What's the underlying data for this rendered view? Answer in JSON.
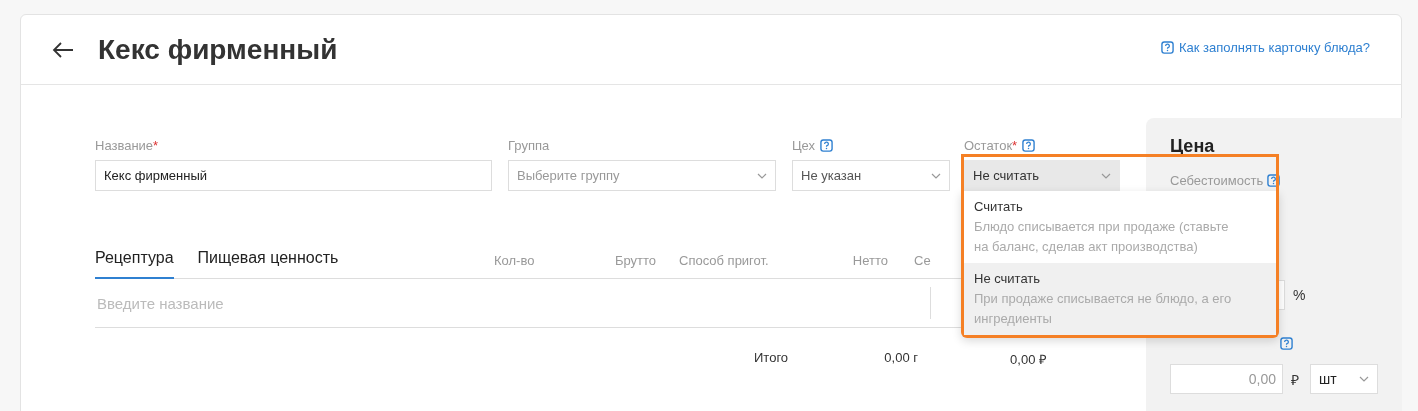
{
  "header": {
    "title": "Кекс фирменный",
    "help_link": "Как заполнять карточку блюда?"
  },
  "fields": [
    {
      "kind": "text",
      "label": "Название",
      "required_mark": "*",
      "help": false,
      "value": "Кекс фирменный"
    },
    {
      "kind": "select",
      "label": "Группа",
      "help": false,
      "placeholder": "Выберите группу"
    },
    {
      "kind": "select",
      "label": "Цех",
      "help": true,
      "value": "Не указан"
    },
    {
      "kind": "select",
      "label": "Остаток",
      "required_mark": "*",
      "help": true,
      "value": "Не считать",
      "expanded": true
    }
  ],
  "stock_options": [
    {
      "title": "Считать",
      "description": "Блюдо списывается при продаже (ставьте на баланс, сделав акт производства)",
      "selected": false
    },
    {
      "title": "Не считать",
      "description": "При продаже списывается не блюдо, а его ингредиенты",
      "selected": true
    }
  ],
  "tabs": [
    {
      "label": "Рецептура",
      "selected": true
    },
    {
      "label": "Пищевая ценность",
      "selected": false
    }
  ],
  "table": {
    "columns": [
      "Кол-во",
      "Брутто",
      "Способ пригот.",
      "Нетто",
      "Се"
    ],
    "ingredient_input": {
      "placeholder": "Введите название"
    },
    "total": {
      "label": "Итого",
      "weight": "0,00 г",
      "cost": "0,00 ₽"
    }
  },
  "price": {
    "title": "Цена",
    "cost_label": "Себестоимость",
    "markup_unit": "%",
    "price_value": "0,00",
    "currency": "₽",
    "unit": "шт"
  }
}
